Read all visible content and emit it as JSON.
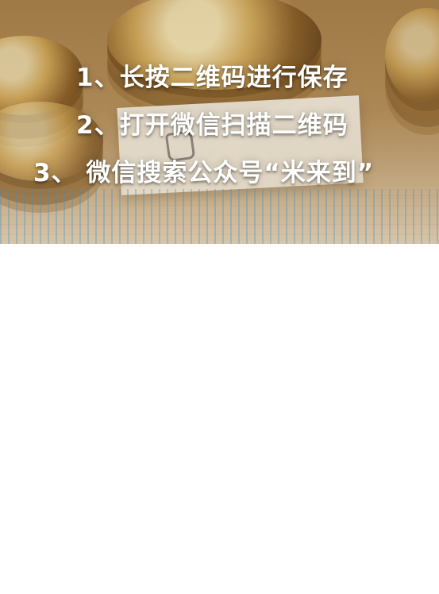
{
  "banner": {
    "instructions": [
      "1、长按二维码进行保存",
      "2、打开微信扫描二维码",
      "3、 微信搜索公众号“米来到”"
    ]
  }
}
